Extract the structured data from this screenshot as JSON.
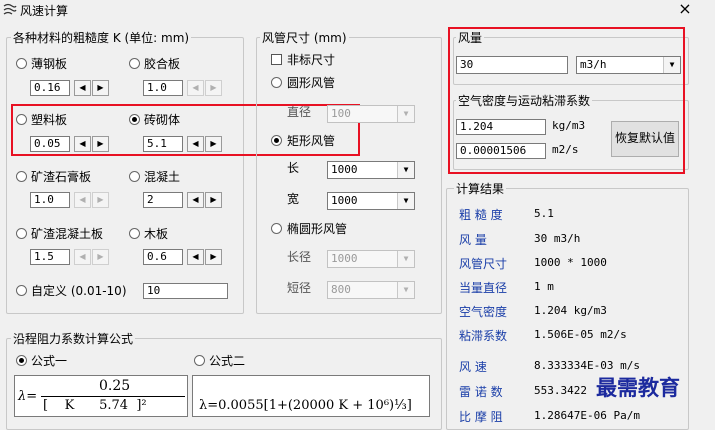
{
  "window": {
    "title": "风速计算",
    "close": "×"
  },
  "roughness": {
    "group_label": "各种材料的粗糙度 K  (单位: mm)",
    "materials": [
      {
        "name": "薄钢板",
        "value": "0.16",
        "selected": false
      },
      {
        "name": "胶合板",
        "value": "1.0",
        "selected": false
      },
      {
        "name": "塑料板",
        "value": "0.05",
        "selected": false
      },
      {
        "name": "砖砌体",
        "value": "5.1",
        "selected": true
      },
      {
        "name": "矿渣石膏板",
        "value": "1.0",
        "selected": false
      },
      {
        "name": "混凝土",
        "value": "2",
        "selected": false
      },
      {
        "name": "矿渣混凝土板",
        "value": "1.5",
        "selected": false
      },
      {
        "name": "木板",
        "value": "0.6",
        "selected": false
      }
    ],
    "custom_label": "自定义 (0.01-10)",
    "custom_value": "10"
  },
  "duct": {
    "group_label": "风管尺寸 (mm)",
    "nonstandard_label": "非标尺寸",
    "circular_label": "圆形风管",
    "diameter_label": "直径",
    "diameter_value": "100",
    "rect_label": "矩形风管",
    "length_label": "长",
    "length_value": "1000",
    "width_label": "宽",
    "width_value": "1000",
    "oval_label": "椭圆形风管",
    "oval_long_label": "长径",
    "oval_long_value": "1000",
    "oval_short_label": "短径",
    "oval_short_value": "800"
  },
  "airflow": {
    "group_label": "风量",
    "value": "30",
    "unit": "m3/h"
  },
  "air_props": {
    "group_label": "空气密度与运动粘滞系数",
    "density_value": "1.204",
    "density_unit": "kg/m3",
    "viscosity_value": "0.00001506",
    "viscosity_unit": "m2/s",
    "restore_button": "恢复默认值"
  },
  "results": {
    "group_label": "计算结果",
    "rows": [
      {
        "key": "粗 糙 度",
        "value": "5.1"
      },
      {
        "key": "风    量",
        "value": "30 m3/h"
      },
      {
        "key": "风管尺寸",
        "value": "1000 * 1000"
      },
      {
        "key": "当量直径",
        "value": "1 m"
      },
      {
        "key": "空气密度",
        "value": "1.204 kg/m3"
      },
      {
        "key": "粘滞系数",
        "value": "1.506E-05 m2/s"
      },
      {
        "key": "风    速",
        "value": "8.333334E-03 m/s"
      },
      {
        "key": "雷 诺 数",
        "value": "553.3422"
      },
      {
        "key": "比 摩 阻",
        "value": "1.28647E-06 Pa/m"
      }
    ]
  },
  "formula": {
    "group_label": "沿程阻力系数计算公式",
    "option1": "公式一",
    "option2": "公式二",
    "f1_lambda": "λ=",
    "f1_num": "0.25",
    "f1_den": "[    K      5.74  ]²",
    "f2_text": "λ=0.0055[1+(20000 K + 10⁶)⅓]"
  },
  "watermark": "最需教育"
}
